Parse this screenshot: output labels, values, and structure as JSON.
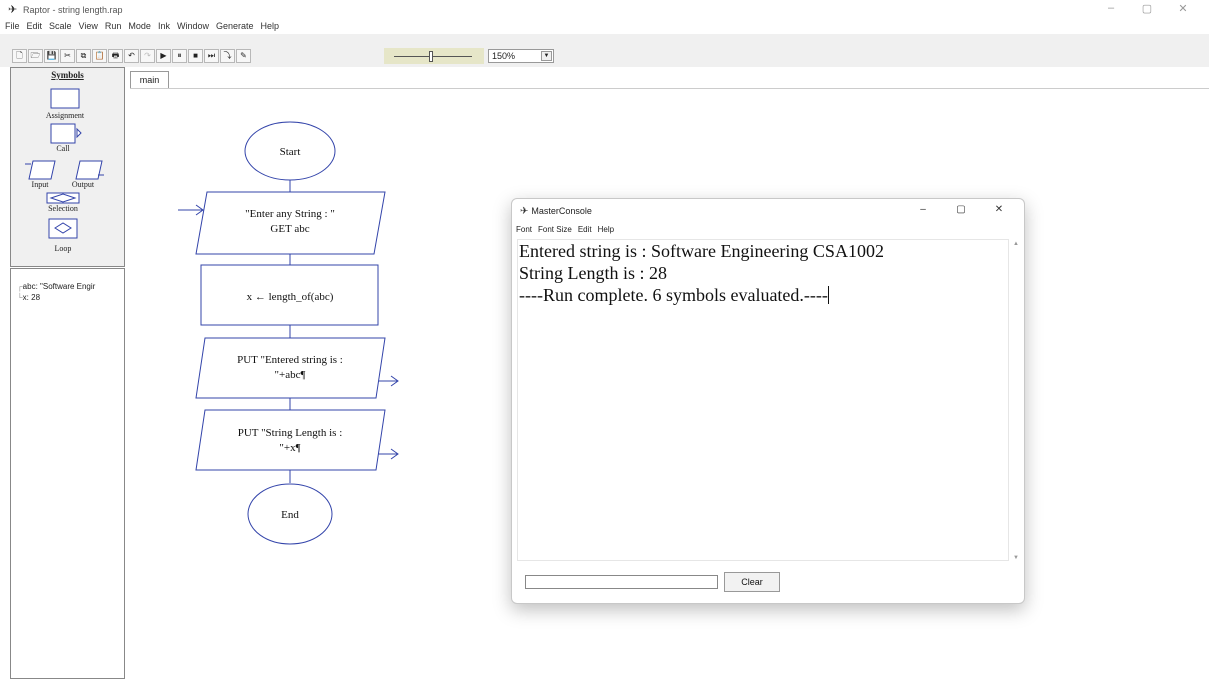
{
  "window": {
    "title": "Raptor - string length.rap",
    "controls": {
      "minimize": "–",
      "maximize": "▢",
      "close": "✕"
    }
  },
  "menu": {
    "items": [
      "File",
      "Edit",
      "Scale",
      "View",
      "Run",
      "Mode",
      "Ink",
      "Window",
      "Generate",
      "Help"
    ]
  },
  "toolbar": {
    "buttons": [
      {
        "icon": "new-file-icon",
        "glyph": "🗋"
      },
      {
        "icon": "open-folder-icon",
        "glyph": "🗁"
      },
      {
        "icon": "save-icon",
        "glyph": "💾"
      },
      {
        "icon": "cut-icon",
        "glyph": "✂"
      },
      {
        "icon": "copy-icon",
        "glyph": "⧉"
      },
      {
        "icon": "paste-icon",
        "glyph": "📋"
      },
      {
        "icon": "print-icon",
        "glyph": "🖶"
      },
      {
        "icon": "undo-icon",
        "glyph": "↶"
      },
      {
        "icon": "redo-icon",
        "glyph": "↷"
      },
      {
        "icon": "play-icon",
        "glyph": "▶"
      },
      {
        "icon": "pause-icon",
        "glyph": "⏸"
      },
      {
        "icon": "stop-icon",
        "glyph": "■"
      },
      {
        "icon": "step-icon",
        "glyph": "⏭"
      },
      {
        "icon": "step-into-icon",
        "glyph": "⤵"
      },
      {
        "icon": "pen-icon",
        "glyph": "✎"
      }
    ],
    "zoom_value": "150%",
    "zoom_arrow": "▼"
  },
  "symbols_panel": {
    "title": "Symbols",
    "items": [
      "Assignment",
      "Call",
      "Input",
      "Output",
      "Selection",
      "Loop"
    ]
  },
  "watch": {
    "vars": [
      {
        "name": "abc",
        "value": "abc: \"Software Engir"
      },
      {
        "name": "x",
        "value": "x: 28"
      }
    ]
  },
  "tabs": {
    "main": "main"
  },
  "flowchart": {
    "start": "Start",
    "input_line1": "\"Enter any String : \"",
    "input_line2": "GET abc",
    "assign": "x ← length_of(abc)",
    "output1_line1": "PUT \"Entered string is :",
    "output1_line2": "\"+abc¶",
    "output2_line1": "PUT \"String Length is :",
    "output2_line2": "\"+x¶",
    "end": "End"
  },
  "console": {
    "title": "MasterConsole",
    "menu": [
      "Font",
      "Font Size",
      "Edit",
      "Help"
    ],
    "lines": [
      "Entered string is : Software Engineering CSA1002",
      "String Length is : 28",
      "----Run complete.  6 symbols evaluated.----"
    ],
    "clear_label": "Clear",
    "controls": {
      "minimize": "–",
      "maximize": "▢",
      "close": "✕"
    },
    "scroll_up": "▲",
    "scroll_down": "▼"
  }
}
